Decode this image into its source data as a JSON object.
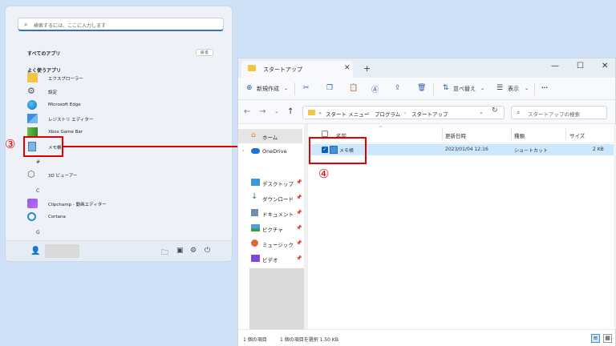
{
  "start_menu": {
    "search_placeholder": "検索するには、ここに入力します",
    "all_apps_title": "すべてのアプリ",
    "back_label": "戻る",
    "frequent_title": "よく使うアプリ",
    "apps": [
      {
        "label": "エクスプローラー"
      },
      {
        "label": "設定"
      },
      {
        "label": "Microsoft Edge"
      },
      {
        "label": "レジストリ エディター"
      },
      {
        "label": "Xbox Game Bar"
      },
      {
        "label": "メモ帳"
      }
    ],
    "letter_hash": "#",
    "apps_hash": [
      {
        "label": "3D ビューアー"
      }
    ],
    "letter_c": "C",
    "apps_c": [
      {
        "label": "Clipchamp - 動画エディター"
      },
      {
        "label": "Cortana"
      }
    ],
    "letter_g": "G"
  },
  "annotations": {
    "step3": "③",
    "step4": "④"
  },
  "explorer": {
    "tab_title": "スタートアップ",
    "toolbar": {
      "new_label": "新規作成",
      "sort_label": "並べ替え",
      "view_label": "表示",
      "more_label": "···"
    },
    "address": {
      "prefix": "«",
      "crumbs": [
        "スタート メニュー",
        "プログラム",
        "スタートアップ"
      ],
      "sep": "›"
    },
    "search_placeholder": "スタートアップの検索",
    "nav": [
      {
        "label": "ホーム"
      },
      {
        "label": "OneDrive"
      },
      {
        "label": "デスクトップ"
      },
      {
        "label": "ダウンロード"
      },
      {
        "label": "ドキュメント"
      },
      {
        "label": "ピクチャ"
      },
      {
        "label": "ミュージック"
      },
      {
        "label": "ビデオ"
      }
    ],
    "columns": {
      "name": "名前",
      "date": "更新日時",
      "type": "種類",
      "size": "サイズ"
    },
    "files": [
      {
        "name": "メモ帳",
        "date": "2023/01/04 12:16",
        "type": "ショートカット",
        "size": "2 KB"
      }
    ],
    "status": {
      "count": "1 個の項目",
      "selected": "1 個の項目を選択  1.50 KB"
    }
  }
}
